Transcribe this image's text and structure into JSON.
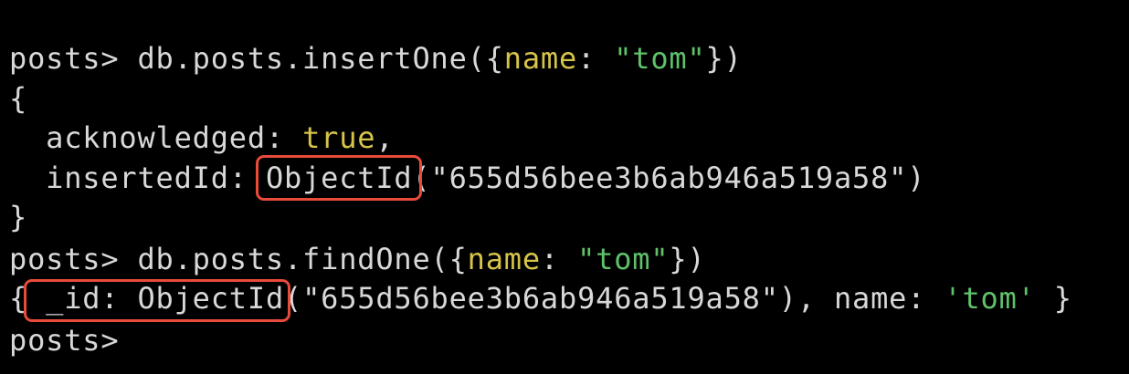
{
  "terminal": {
    "background": "#000000",
    "text_color": "#d8d8d8",
    "key_color": "#d6c34a",
    "string_color": "#5fc26b",
    "highlight_color": "#e84b3a",
    "lines": {
      "l1": {
        "prompt": "posts> ",
        "command_pre": "db.posts.insertOne({",
        "key": "name",
        "colon": ": ",
        "value": "\"tom\"",
        "command_post": "})"
      },
      "l2": {
        "text": "{"
      },
      "l3": {
        "indent": "  ",
        "key": "acknowledged",
        "colon": ": ",
        "value": "true",
        "comma": ","
      },
      "l4": {
        "indent": "  ",
        "key": "insertedId",
        "colon": ": ",
        "fn": "ObjectId",
        "arg": "(\"655d56bee3b6ab946a519a58\")"
      },
      "l5": {
        "text": "}"
      },
      "l6": {
        "prompt": "posts> ",
        "command_pre": "db.posts.findOne({",
        "key": "name",
        "colon": ": ",
        "value": "\"tom\"",
        "command_post": "})"
      },
      "l7": {
        "open": "{ ",
        "key": "_id",
        "colon": ": ",
        "fn": "ObjectId",
        "arg": "(\"655d56bee3b6ab946a519a58\"), ",
        "key2": "name",
        "colon2": ": ",
        "value2": "'tom'",
        "close": " }"
      },
      "l8": {
        "prompt": "posts> "
      }
    }
  }
}
